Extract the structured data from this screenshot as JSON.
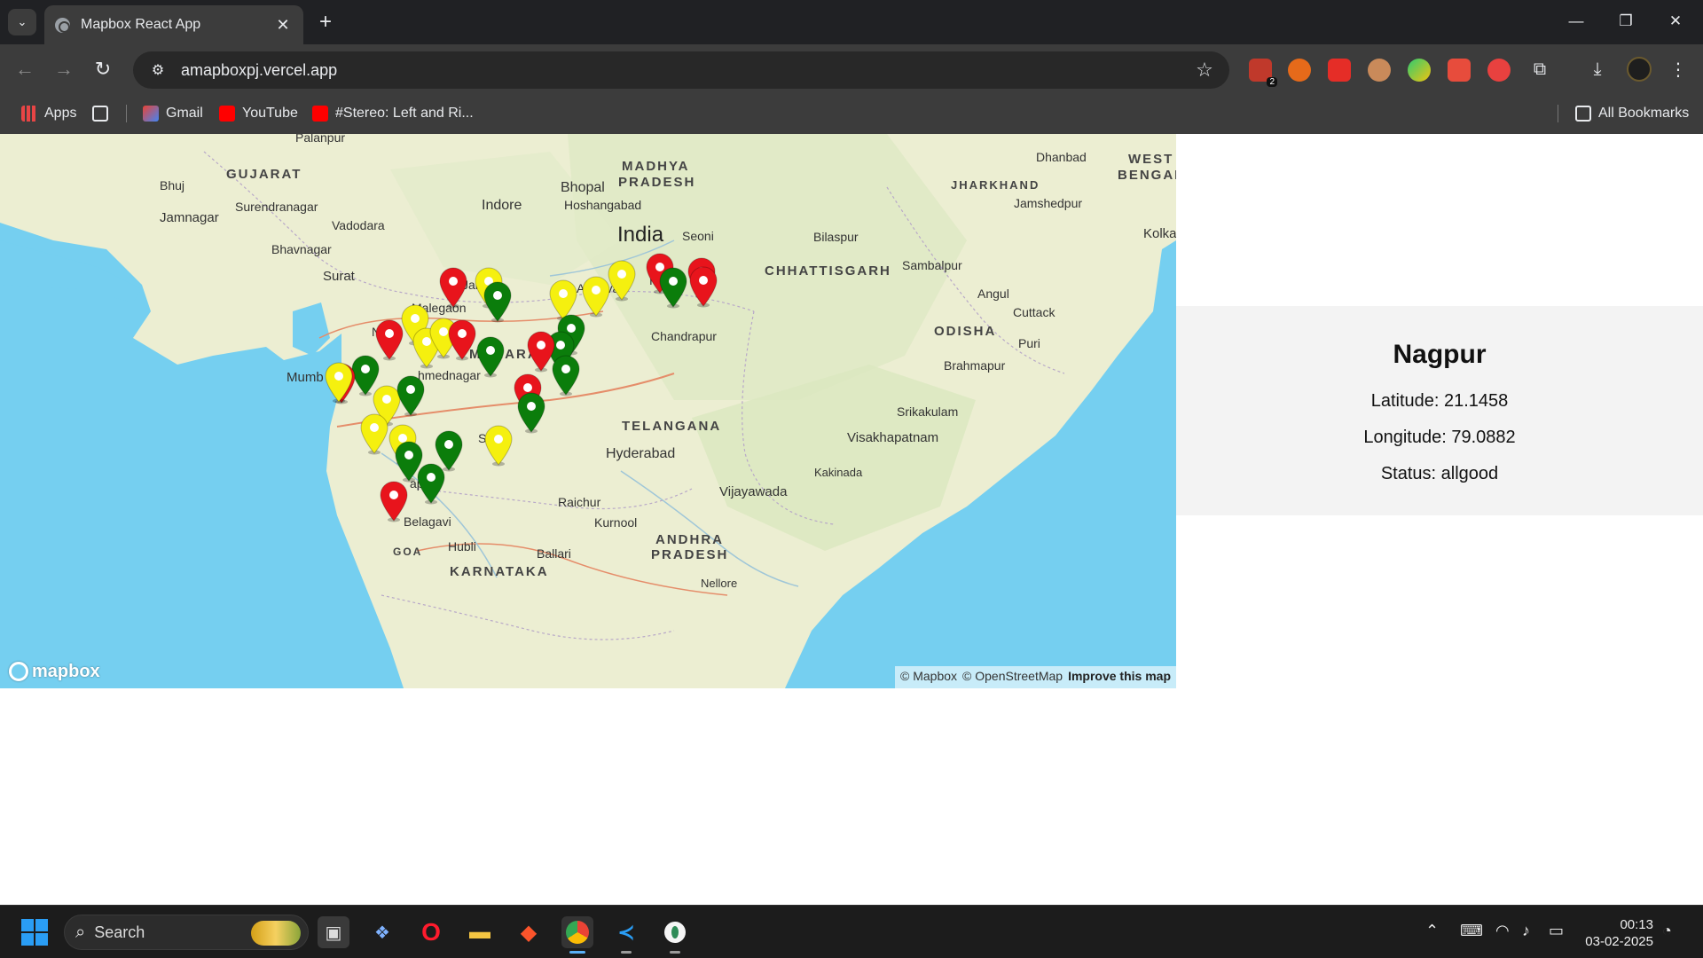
{
  "browser": {
    "tab_title": "Mapbox React App",
    "url": "amapboxpj.vercel.app",
    "extension_badge": "2",
    "icons": [
      "tab-search-icon",
      "close-icon",
      "plus-icon",
      "minimize-icon",
      "restore-icon",
      "window-close-icon",
      "back-icon",
      "forward-icon",
      "reload-icon",
      "site-info-icon",
      "star-icon",
      "puzzle-icon",
      "download-icon"
    ]
  },
  "bookmarks": {
    "apps": "Apps",
    "gmail": "Gmail",
    "youtube": "YouTube",
    "stereo": "#Stereo: Left and Ri...",
    "all": "All Bookmarks"
  },
  "map": {
    "labels": {
      "palanpur": "Palanpur",
      "gujarat": "GUJARAT",
      "madhya_pradesh_1": "MADHYA",
      "madhya_pradesh_2": "PRADESH",
      "bhopal": "Bhopal",
      "dhanbad": "Dhanbad",
      "west_bengal_1": "WEST",
      "west_bengal_2": "BENGAL",
      "bhuj": "Bhuj",
      "jharkhand": "JHARKHAND",
      "surendranagar": "Surendranagar",
      "indore": "Indore",
      "hoshangabad": "Hoshangabad",
      "jamshedpur": "Jamshedpur",
      "jamnagar": "Jamnagar",
      "vadodara": "Vadodara",
      "india": "India",
      "seoni": "Seoni",
      "bilaspur": "Bilaspur",
      "kolkata": "Kolka",
      "bhavnagar": "Bhavnagar",
      "chhattisgarh": "CHHATTISGARH",
      "sambalpur": "Sambalpur",
      "surat": "Surat",
      "jalgaon": "Jalg",
      "amravati": "Amravati",
      "nagpur": "Nag",
      "angul": "Angul",
      "malegaon": "Malegaon",
      "cuttack": "Cuttack",
      "nashik": "N",
      "odisha": "ODISHA",
      "chandrapur": "Chandrapur",
      "puri": "Puri",
      "maharashtra": "MAHARAS",
      "brahmapur": "Brahmapur",
      "mumbai": "Mumb",
      "ahmednagar": "hmednagar",
      "srikakulam": "Srikakulam",
      "pune": "P",
      "telangana": "TELANGANA",
      "visakhapatnam": "Visakhapatnam",
      "solapur": "So",
      "hyderabad": "Hyderabad",
      "kolhapur": "apur",
      "kakinada": "Kakinada",
      "vijayawada": "Vijayawada",
      "belagavi": "Belagavi",
      "raichur": "Raichur",
      "kurnool": "Kurnool",
      "hubli": "Hubli",
      "andhra_1": "ANDHRA",
      "andhra_2": "PRADESH",
      "goa": "GOA",
      "ballari": "Ballari",
      "karnataka": "KARNATAKA",
      "nellore": "Nellore"
    },
    "markers": [
      {
        "status": "red"
      },
      {
        "status": "yellow"
      },
      {
        "status": "green"
      },
      {
        "status": "yellow"
      },
      {
        "status": "yellow"
      },
      {
        "status": "yellow"
      },
      {
        "status": "red"
      },
      {
        "status": "green"
      },
      {
        "status": "red"
      },
      {
        "status": "red"
      },
      {
        "status": "yellow"
      },
      {
        "status": "yellow"
      },
      {
        "status": "yellow"
      },
      {
        "status": "red"
      },
      {
        "status": "green"
      },
      {
        "status": "red"
      },
      {
        "status": "green"
      },
      {
        "status": "green"
      },
      {
        "status": "red"
      },
      {
        "status": "green"
      },
      {
        "status": "yellow"
      },
      {
        "status": "yellow"
      },
      {
        "status": "green"
      },
      {
        "status": "red"
      },
      {
        "status": "green"
      },
      {
        "status": "yellow"
      },
      {
        "status": "green"
      },
      {
        "status": "yellow"
      },
      {
        "status": "yellow"
      },
      {
        "status": "green"
      },
      {
        "status": "green"
      },
      {
        "status": "red"
      },
      {
        "status": "green"
      },
      {
        "status": "red"
      }
    ],
    "marker_colors": {
      "red": "#e8141c",
      "yellow": "#f5f00f",
      "green": "#0b7d0b"
    },
    "logo_text": "mapbox",
    "attribution_mapbox": "© Mapbox",
    "attribution_osm": "© OpenStreetMap",
    "attribution_improve": "Improve this map"
  },
  "info": {
    "city": "Nagpur",
    "latitude": "Latitude: 21.1458",
    "longitude": "Longitude: 79.0882",
    "status": "Status: allgood"
  },
  "taskbar": {
    "search_placeholder": "Search",
    "time": "00:13",
    "date": "03-02-2025",
    "apps": [
      "windows-start-icon",
      "task-view-icon",
      "copilot-icon",
      "opera-icon",
      "file-explorer-icon",
      "brave-icon",
      "chrome-icon",
      "vscode-icon",
      "app-icon"
    ],
    "tray": [
      "chevron-up-icon",
      "keyboard-icon",
      "wifi-icon",
      "volume-icon",
      "battery-icon",
      "notification-icon"
    ]
  }
}
